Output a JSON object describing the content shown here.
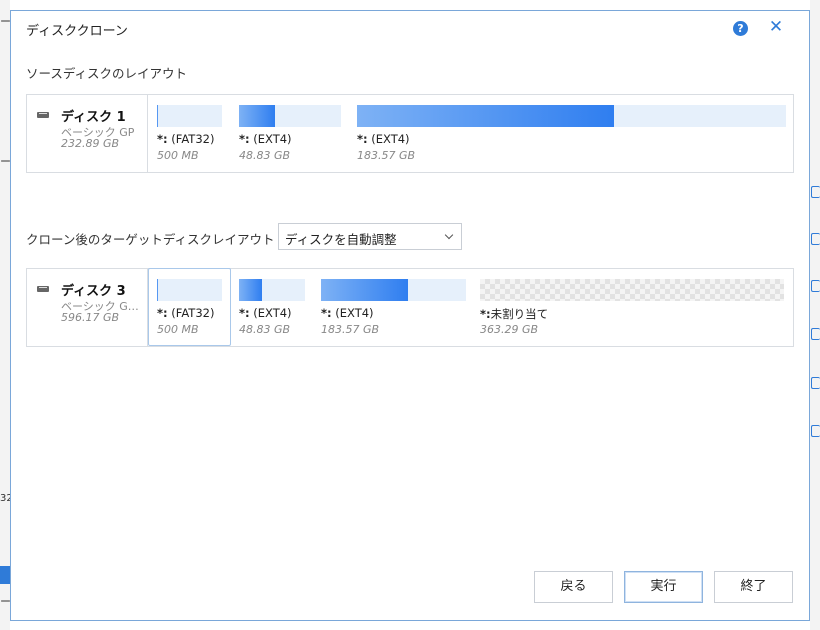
{
  "dialog": {
    "title": "ディスククローン",
    "help_icon": "?",
    "close_icon": "✕"
  },
  "source": {
    "label": "ソースディスクのレイアウト",
    "disk": {
      "name": "ディスク 1",
      "type": "ベーシック GP",
      "size": "232.89 GB"
    },
    "partitions": [
      {
        "prefix": "*:",
        "fs": "(FAT32)",
        "size": "500 MB",
        "used_fraction": 0.02
      },
      {
        "prefix": "*:",
        "fs": "(EXT4)",
        "size": "48.83 GB",
        "used_fraction": 0.35
      },
      {
        "prefix": "*:",
        "fs": "(EXT4)",
        "size": "183.57 GB",
        "used_fraction": 0.6
      }
    ]
  },
  "target": {
    "label": "クローン後のターゲットディスクレイアウト",
    "layout_select": {
      "value": "ディスクを自動調整"
    },
    "disk": {
      "name": "ディスク 3",
      "type": "ベーシック G…",
      "size": "596.17 GB"
    },
    "partitions": [
      {
        "prefix": "*:",
        "fs": "(FAT32)",
        "size": "500 MB",
        "used_fraction": 0.02
      },
      {
        "prefix": "*:",
        "fs": "(EXT4)",
        "size": "48.83 GB",
        "used_fraction": 0.35
      },
      {
        "prefix": "*:",
        "fs": "(EXT4)",
        "size": "183.57 GB",
        "used_fraction": 0.6
      },
      {
        "prefix": "*:",
        "fs": "未割り当て",
        "size": "363.29 GB",
        "used_fraction": 0
      }
    ]
  },
  "buttons": {
    "back": "戻る",
    "execute": "実行",
    "finish": "終了"
  },
  "background": {
    "frag1": "ー",
    "frag2": "ー",
    "frag3": "32",
    "frag4": "ー"
  },
  "colors": {
    "accent": "#2f7bd8",
    "bar_fill": "#2f7ef0",
    "bar_empty": "#e6f0fb"
  }
}
